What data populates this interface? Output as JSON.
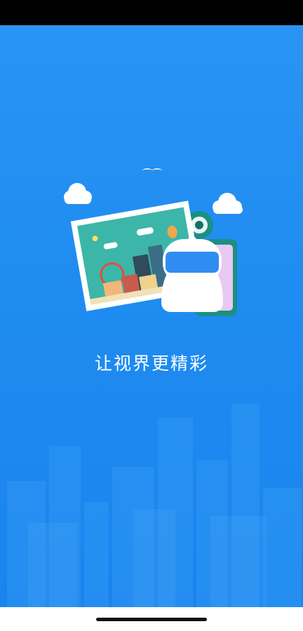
{
  "splash": {
    "tagline": "让视界更精彩"
  },
  "colors": {
    "background": "#1e8ff2",
    "status_bar": "#000000",
    "text": "#ffffff"
  },
  "icons": [
    "cloud-icon",
    "bird-icon",
    "photo-icon",
    "robot-icon",
    "camera-icon",
    "skyline-icon"
  ]
}
